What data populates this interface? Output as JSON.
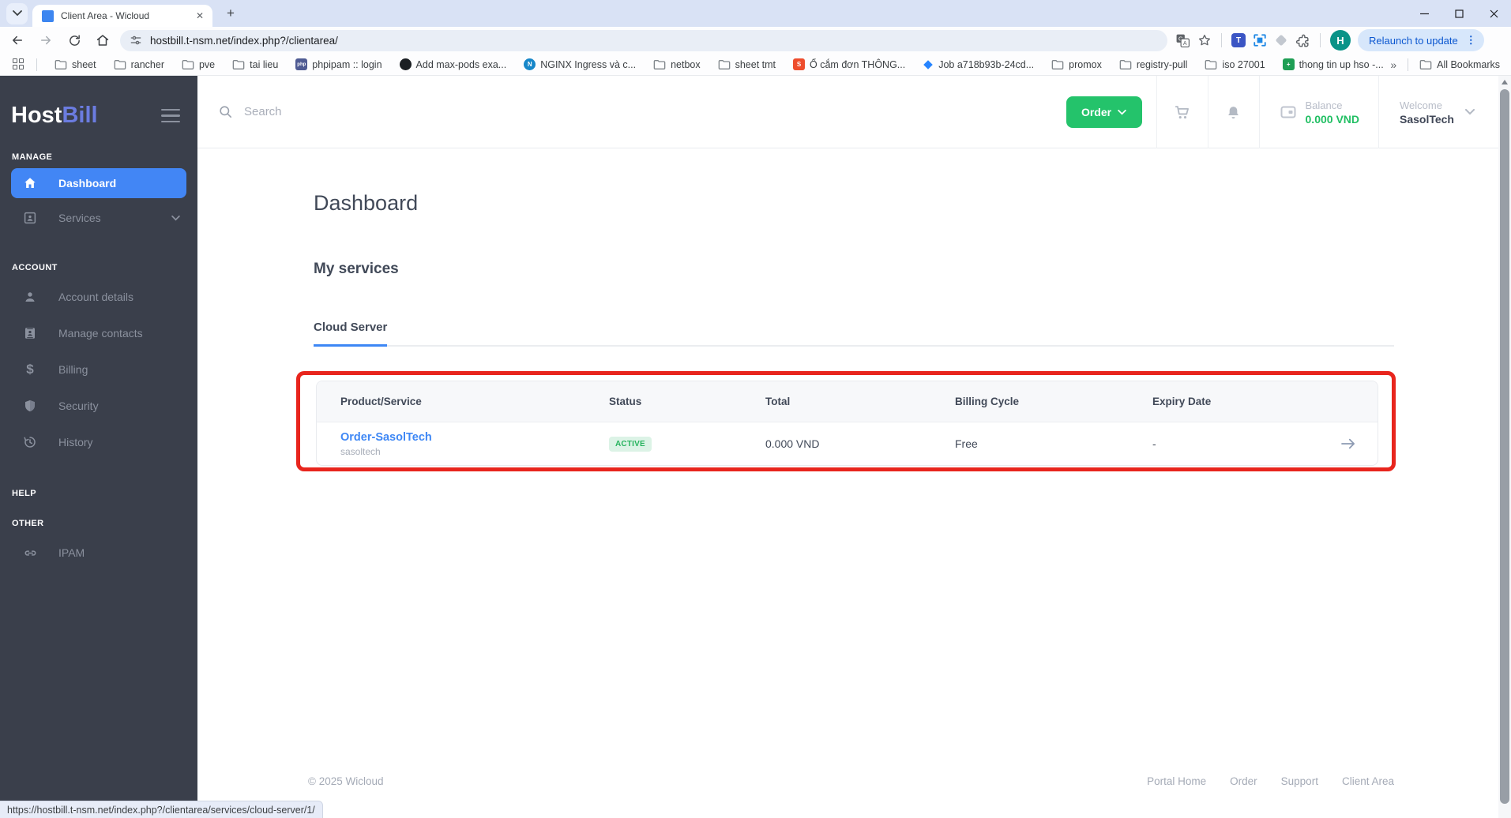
{
  "colors": {
    "accent_blue": "#4286f5",
    "link_blue": "#3e87f5",
    "brand_green": "#24c36b",
    "status_green": "#27b35e",
    "status_green_bg": "#dcf3e6",
    "sidebar_bg": "#3a3f4b",
    "annotation_red": "#e8251d",
    "logo_bill_blue": "#6b7ce0",
    "chrome_titlebar": "#d9e2f5"
  },
  "browser": {
    "tab_title": "Client Area - Wicloud",
    "url": "hostbill.t-nsm.net/index.php?/clientarea/",
    "avatar_letter": "H",
    "relaunch_label": "Relaunch to update",
    "menu_dots": "⋮",
    "new_tab_plus": "+",
    "close_tab": "✕",
    "bookmarks": [
      {
        "label": "sheet",
        "icon": "folder"
      },
      {
        "label": "rancher",
        "icon": "folder"
      },
      {
        "label": "pve",
        "icon": "folder"
      },
      {
        "label": "tai lieu",
        "icon": "folder"
      },
      {
        "label": "phpipam :: login",
        "icon": "php"
      },
      {
        "label": "Add max-pods exa...",
        "icon": "github"
      },
      {
        "label": "NGINX Ingress và c...",
        "icon": "nginx"
      },
      {
        "label": "netbox",
        "icon": "folder"
      },
      {
        "label": "sheet tmt",
        "icon": "folder"
      },
      {
        "label": "Ổ cắm đơn THÔNG...",
        "icon": "shopee"
      },
      {
        "label": "Job a718b93b-24cd...",
        "icon": "jira"
      },
      {
        "label": "promox",
        "icon": "folder"
      },
      {
        "label": "registry-pull",
        "icon": "folder"
      },
      {
        "label": "iso 27001",
        "icon": "folder"
      },
      {
        "label": "thong tin up hso -...",
        "icon": "sheets"
      }
    ],
    "overflow_chevron": "»",
    "all_bookmarks_label": "All Bookmarks",
    "status_bar_url": "https://hostbill.t-nsm.net/index.php?/clientarea/services/cloud-server/1/"
  },
  "sidebar": {
    "logo_part1": "Host",
    "logo_part2": "Bill",
    "sections": [
      {
        "label": "MANAGE"
      },
      {
        "label": "ACCOUNT"
      },
      {
        "label": "HELP"
      },
      {
        "label": "OTHER"
      }
    ],
    "items": {
      "dashboard": "Dashboard",
      "services": "Services",
      "account_details": "Account details",
      "manage_contacts": "Manage contacts",
      "billing": "Billing",
      "security": "Security",
      "history": "History",
      "ipam": "IPAM"
    }
  },
  "header": {
    "search_placeholder": "Search",
    "order_label": "Order",
    "balance_label": "Balance",
    "balance_value": "0.000 VND",
    "welcome_label": "Welcome",
    "username": "SasolTech"
  },
  "main": {
    "page_title": "Dashboard",
    "section_title": "My services",
    "tab_label": "Cloud Server",
    "table": {
      "columns": [
        "Product/Service",
        "Status",
        "Total",
        "Billing Cycle",
        "Expiry Date"
      ],
      "row": {
        "product": "Order-SasolTech",
        "subtitle": "sasoltech",
        "status": "ACTIVE",
        "total": "0.000 VND",
        "billing_cycle": "Free",
        "expiry": "-"
      }
    }
  },
  "footer": {
    "copyright": "© 2025 Wicloud",
    "links": [
      "Portal Home",
      "Order",
      "Support",
      "Client Area"
    ]
  }
}
